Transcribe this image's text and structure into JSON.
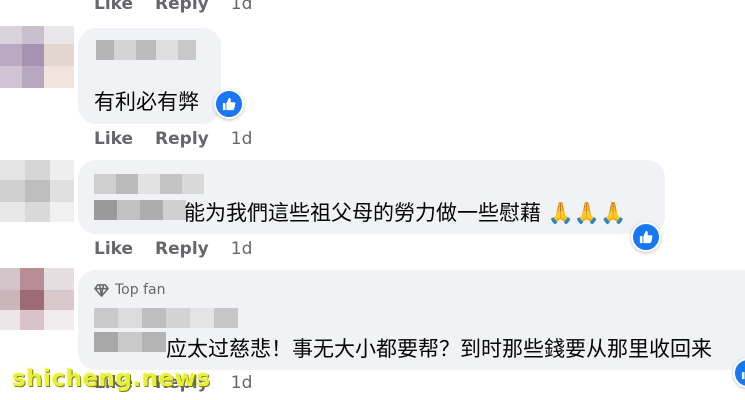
{
  "actions": {
    "like": "Like",
    "reply": "Reply",
    "time": "1d"
  },
  "comments": [
    {
      "text": "有利必有弊"
    },
    {
      "text": "能为我們這些祖父母的勞力做一些慰藉 🙏🙏🙏"
    },
    {
      "badge": "Top fan",
      "text": "应太过慈悲！事无大小都要帮？到时那些錢要从那里收回来"
    }
  ],
  "watermark": "shicheng.news",
  "colors": {
    "bubble": "#f0f2f5",
    "like_blue": "#1877f2",
    "meta_gray": "#65676b",
    "watermark": "#e8ef3a"
  }
}
